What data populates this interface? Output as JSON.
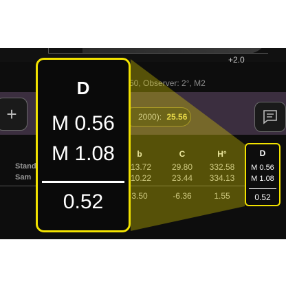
{
  "graph": {
    "tick_label": "+2.0"
  },
  "observer_text": "50, Observer: 2°, M2",
  "delta": {
    "label": "2000):",
    "value": "25.56"
  },
  "table": {
    "headers": [
      "b",
      "C",
      "H°"
    ],
    "row_labels": [
      "Stand",
      "Sam"
    ],
    "rows": [
      [
        "-13.72",
        "29.80",
        "332.58"
      ],
      [
        "-10.22",
        "23.44",
        "334.13"
      ],
      [
        "3.50",
        "-6.36",
        "1.55"
      ]
    ]
  },
  "highlight": {
    "header": "D",
    "value_1": "M 0.56",
    "value_2": "M 1.08",
    "difference": "0.52"
  },
  "colors": {
    "highlight": "#f2e200",
    "band": "#3b2e3f",
    "background": "#0d0d0d"
  }
}
